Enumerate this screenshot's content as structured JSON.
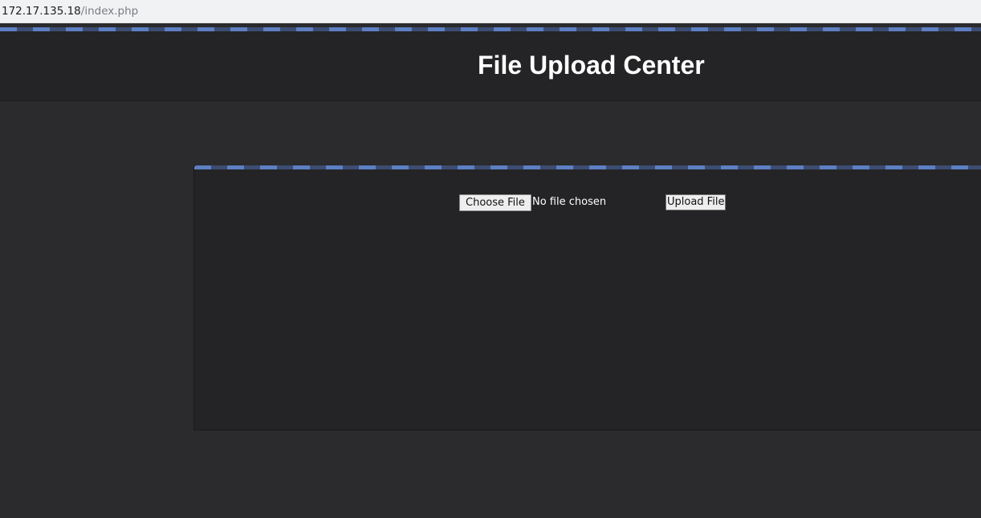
{
  "browser": {
    "url_host": "172.17.135.18",
    "url_path": "/index.php"
  },
  "header": {
    "title": "File Upload Center"
  },
  "upload_form": {
    "choose_file_label": "Choose File",
    "file_status": "No file chosen",
    "submit_label": "Upload File"
  },
  "colors": {
    "stripe_light": "#5d7fc3",
    "stripe_dark": "#3c4d72",
    "background": "#2b2b2d",
    "panel": "#242426"
  }
}
